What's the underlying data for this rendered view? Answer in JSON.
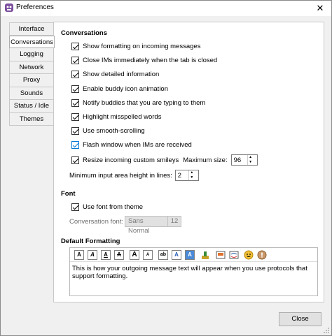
{
  "window": {
    "title": "Preferences"
  },
  "tabs": [
    {
      "label": "Interface"
    },
    {
      "label": "Conversations"
    },
    {
      "label": "Logging"
    },
    {
      "label": "Network"
    },
    {
      "label": "Proxy"
    },
    {
      "label": "Sounds"
    },
    {
      "label": "Status / Idle"
    },
    {
      "label": "Themes"
    }
  ],
  "conversations": {
    "heading": "Conversations",
    "options": [
      {
        "label": "Show formatting on incoming messages",
        "checked": true
      },
      {
        "label": "Close IMs immediately when the tab is closed",
        "checked": true
      },
      {
        "label": "Show detailed information",
        "checked": true
      },
      {
        "label": "Enable buddy icon animation",
        "checked": true
      },
      {
        "label": "Notify buddies that you are typing to them",
        "checked": true
      },
      {
        "label": "Highlight misspelled words",
        "checked": true
      },
      {
        "label": "Use smooth-scrolling",
        "checked": true
      },
      {
        "label": "Flash window when IMs are received",
        "checked": true
      }
    ],
    "smileys_label": "Resize incoming custom smileys",
    "max_size_label": "Maximum size:",
    "max_size_value": "96",
    "min_height_label": "Minimum input area height in lines:",
    "min_height_value": "2"
  },
  "font": {
    "heading": "Font",
    "use_theme_label": "Use font from theme",
    "conv_font_label": "Conversation font:",
    "font_name": "Sans Normal",
    "font_size": "12"
  },
  "default_formatting": {
    "heading": "Default Formatting",
    "sample_text": "This is how your outgoing message text will appear when you use protocols that support formatting."
  },
  "buttons": {
    "close_label": "Close"
  },
  "colors": {
    "accent": "#0078d7",
    "panel_bg": "#ffffff",
    "window_bg": "#f0f0f0"
  }
}
